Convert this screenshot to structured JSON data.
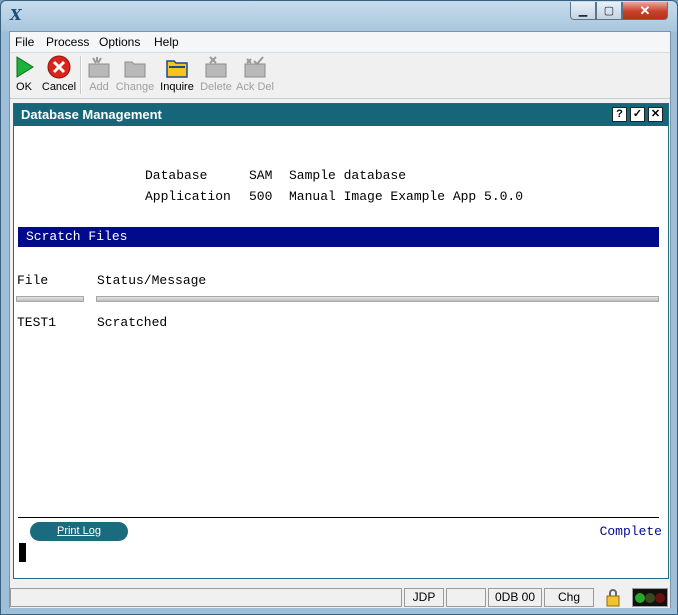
{
  "window": {
    "icon": "x-app-icon",
    "close_glyph": "✕",
    "max_glyph": "▢",
    "min_glyph": "▁"
  },
  "menu": [
    "File",
    "Process",
    "Options",
    "Help"
  ],
  "toolbar": {
    "ok": "OK",
    "cancel": "Cancel",
    "add": "Add",
    "change": "Change",
    "inquire": "Inquire",
    "delete": "Delete",
    "ack_del": "Ack Del"
  },
  "panel": {
    "title": "Database Management",
    "help_glyph": "?",
    "check_glyph": "✓",
    "close_glyph": "✕"
  },
  "info": {
    "database_label": "Database",
    "database_code": "SAM",
    "database_desc": "Sample database",
    "application_label": "Application",
    "application_code": "500",
    "application_desc": "Manual Image Example App 5.0.0"
  },
  "section": {
    "title": "Scratch Files"
  },
  "table": {
    "headers": [
      "File",
      "Status/Message"
    ],
    "rows": [
      {
        "file": "TEST1",
        "status": "Scratched"
      }
    ]
  },
  "footer": {
    "print_log": "Print Log",
    "status": "Complete"
  },
  "statusbar": {
    "user": "JDP",
    "db": "0DB 00",
    "mode": "Chg"
  },
  "colors": {
    "panel_header": "#16667a",
    "section_bar": "#000a8a",
    "close_red": "#c9412a"
  }
}
